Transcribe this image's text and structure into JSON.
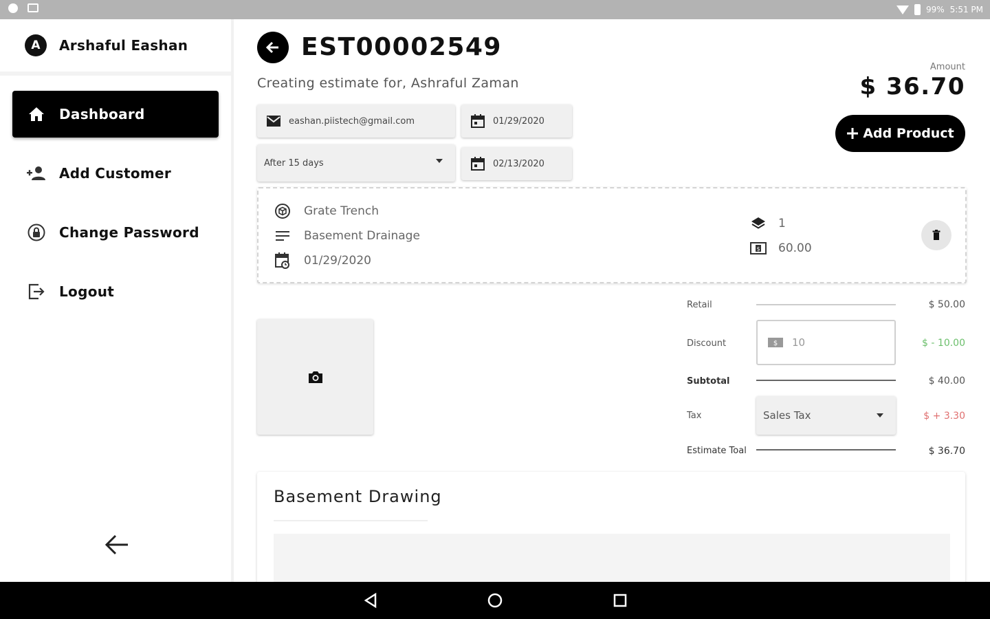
{
  "status_bar": {
    "battery": "99%",
    "time": "5:51 PM"
  },
  "sidebar": {
    "user": {
      "initial": "A",
      "name": "Arshaful Eashan"
    },
    "items": [
      {
        "label": "Dashboard",
        "icon": "home-icon",
        "active": true
      },
      {
        "label": "Add Customer",
        "icon": "add-person-icon",
        "active": false
      },
      {
        "label": "Change Password",
        "icon": "lock-icon",
        "active": false
      },
      {
        "label": "Logout",
        "icon": "logout-icon",
        "active": false
      }
    ]
  },
  "header": {
    "estimate_id": "EST00002549",
    "subtitle": "Creating estimate for, Ashraful Zaman",
    "amount_label": "Amount",
    "amount_value": "$ 36.70",
    "add_product_label": "Add Product"
  },
  "form": {
    "email": "eashan.piistech@gmail.com",
    "date_issued": "01/29/2020",
    "terms": "After 15 days",
    "date_due": "02/13/2020"
  },
  "product": {
    "name": "Grate Trench",
    "description": "Basement Drainage",
    "date": "01/29/2020",
    "quantity": "1",
    "price": "60.00"
  },
  "totals": {
    "retail_label": "Retail",
    "retail_value": "$ 50.00",
    "discount_label": "Discount",
    "discount_input": "10",
    "discount_value": "$ - 10.00",
    "subtotal_label": "Subtotal",
    "subtotal_value": "$ 40.00",
    "tax_label": "Tax",
    "tax_select": "Sales Tax",
    "tax_value": "$ + 3.30",
    "total_label": "Estimate Toal",
    "total_value": "$ 36.70"
  },
  "drawing": {
    "title": "Basement Drawing"
  },
  "colors": {
    "accent": "#000000",
    "discount": "#6cbf6c",
    "tax": "#e07070",
    "field_bg": "#f0f0f0"
  }
}
